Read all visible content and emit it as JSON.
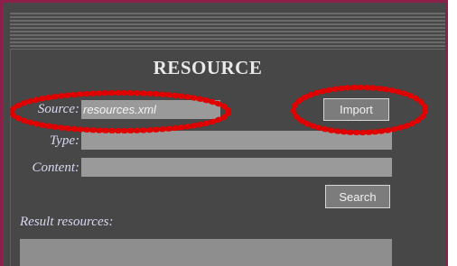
{
  "form": {
    "title": "RESOURCE",
    "source_label": "Source:",
    "source_value": "resources.xml",
    "type_label": "Type:",
    "content_label": "Content:",
    "import_label": "Import",
    "search_label": "Search",
    "result_label": "Result resources:"
  },
  "colors": {
    "panel_bg": "#474747",
    "frame_border": "#8c1f4a",
    "annotation_red": "#e00000",
    "label_text": "#d8d8f2"
  }
}
